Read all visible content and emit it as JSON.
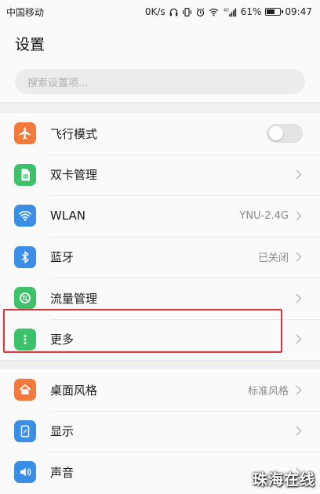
{
  "status_bar": {
    "carrier": "中国移动",
    "net_speed": "0K/s",
    "signal_label": "4G",
    "battery_text": "61%",
    "battery_level": 0.61,
    "time": "09:47"
  },
  "header": {
    "title": "设置"
  },
  "search": {
    "placeholder": "搜索设置项..."
  },
  "group1": [
    {
      "id": "airplane",
      "label": "飞行模式",
      "icon": "airplane-icon",
      "color": "#f47a3c",
      "control": "toggle",
      "toggle_on": false
    },
    {
      "id": "dual-sim",
      "label": "双卡管理",
      "icon": "sim-card-icon",
      "color": "#3ec16b",
      "control": "chevron"
    },
    {
      "id": "wlan",
      "label": "WLAN",
      "icon": "wifi-icon",
      "color": "#3a8ee6",
      "value": "YNU-2.4G",
      "control": "chevron"
    },
    {
      "id": "bluetooth",
      "label": "蓝牙",
      "icon": "bluetooth-icon",
      "color": "#3a8ee6",
      "value": "已关闭",
      "control": "chevron"
    },
    {
      "id": "data-usage",
      "label": "流量管理",
      "icon": "data-usage-icon",
      "color": "#3ec16b",
      "control": "chevron"
    },
    {
      "id": "more",
      "label": "更多",
      "icon": "more-dots-icon",
      "color": "#3ec16b",
      "control": "chevron",
      "highlighted": true
    }
  ],
  "group2": [
    {
      "id": "home-style",
      "label": "桌面风格",
      "icon": "home-icon",
      "color": "#f47a3c",
      "value": "标准风格",
      "control": "chevron"
    },
    {
      "id": "display",
      "label": "显示",
      "icon": "display-icon",
      "color": "#3a8ee6",
      "control": "chevron"
    },
    {
      "id": "sound",
      "label": "声音",
      "icon": "speaker-icon",
      "color": "#3a8ee6",
      "control": "chevron"
    }
  ],
  "highlight_color": "#d9343f",
  "watermark": "珠海在线"
}
